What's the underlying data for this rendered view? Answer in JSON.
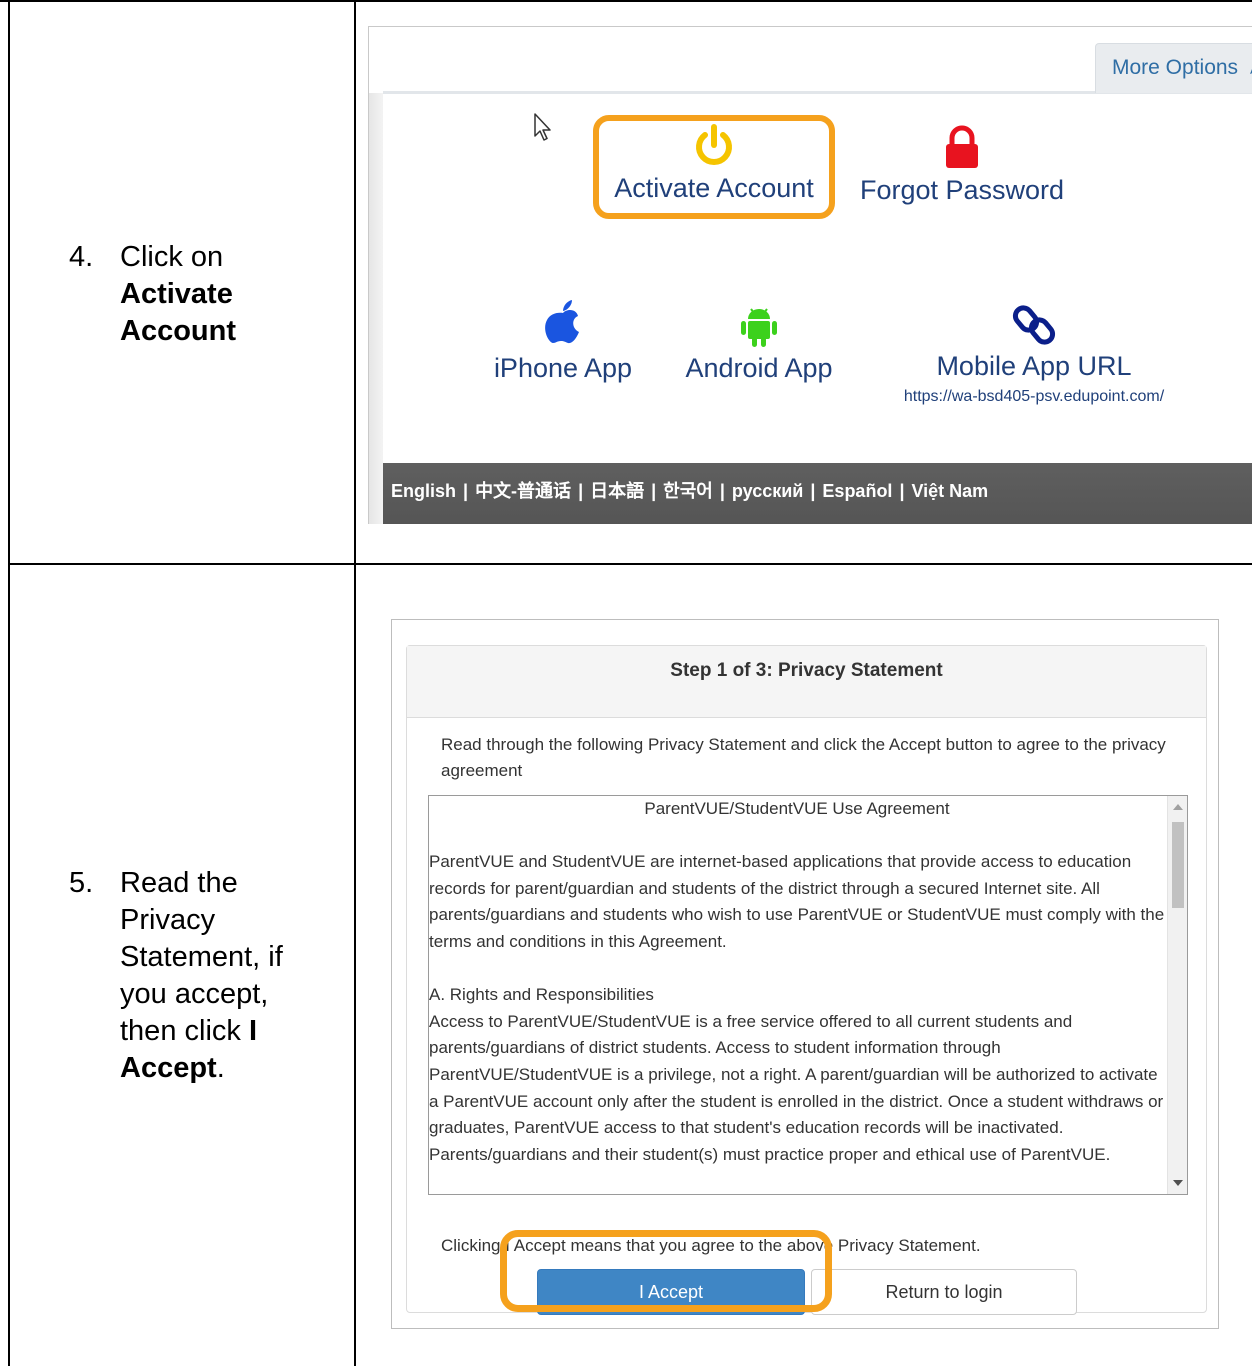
{
  "steps": [
    {
      "number": "4.",
      "line1": "Click on",
      "line2": "Activate",
      "line3": "Account"
    },
    {
      "number": "5.",
      "line1": "Read the",
      "line2": "Privacy",
      "line3": "Statement, if",
      "line4": "you accept,",
      "line5_prefix": "then click ",
      "line5_bold": "I",
      "line6_bold": "Accept",
      "line6_suffix": "."
    }
  ],
  "login_screen": {
    "more_options": "More Options",
    "tiles": {
      "activate": "Activate Account",
      "forgot": "Forgot Password",
      "iphone": "iPhone App",
      "android": "Android App",
      "mobile_url": "Mobile App URL",
      "mobile_url_link": "https://wa-bsd405-psv.edupoint.com/"
    },
    "languages": [
      "English",
      "中文-普通话",
      "日本語",
      "한국어",
      "русский",
      "Español",
      "Việt Nam"
    ],
    "language_separator": "|",
    "colors": {
      "highlight": "#f5a11d",
      "power_icon": "#f5c400",
      "lock_icon": "#e8131f",
      "apple_icon": "#1a55e0",
      "android_icon": "#3cd11c",
      "link_icon": "#0b1f8a",
      "link_text": "#20407a",
      "lang_bar": "#595959"
    }
  },
  "privacy_screen": {
    "title": "Step 1 of 3: Privacy Statement",
    "intro": "Read through the following Privacy Statement and click the Accept button to agree to the privacy agreement",
    "agreement_title": "ParentVUE/StudentVUE Use Agreement",
    "agreement_para1": "ParentVUE and StudentVUE are internet-based applications that provide access to education records for parent/guardian and students of the district through a secured Internet site. All parents/guardians and students who wish to use ParentVUE or StudentVUE must comply with the terms and conditions in this Agreement.",
    "agreement_section": "A. Rights and Responsibilities",
    "agreement_para2": "Access to ParentVUE/StudentVUE is a free service offered to all current students and parents/guardians of district students. Access to student information through ParentVUE/StudentVUE is a privilege, not a right. A parent/guardian will be authorized to activate a ParentVUE account only after the student is enrolled in the district. Once a student withdraws or graduates, ParentVUE access to that student's education records will be inactivated. Parents/guardians and their student(s) must practice proper and ethical use of ParentVUE.",
    "clicking_text": "Clicking I Accept means that you agree to the above Privacy Statement.",
    "accept_button": "I Accept",
    "return_button": "Return to login",
    "colors": {
      "accept_bg": "#3f86c5",
      "highlight": "#f5a11d"
    }
  }
}
